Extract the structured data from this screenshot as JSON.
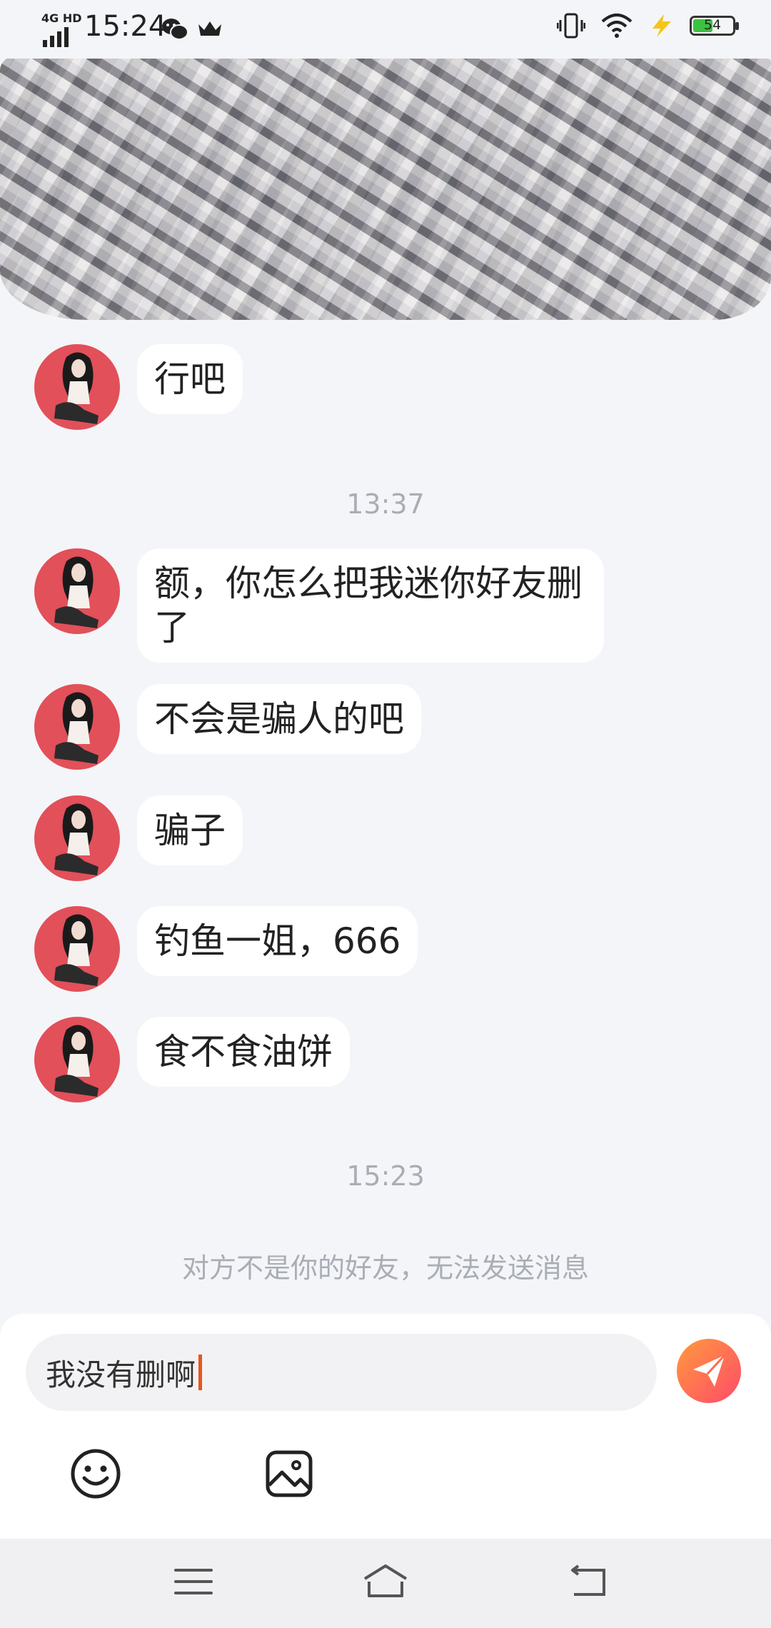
{
  "status_bar": {
    "time": "15:24",
    "network": "4G HD",
    "battery": "54",
    "battery_level": 0.54,
    "icons": [
      "signal-icon",
      "wechat-icon",
      "crown-icon",
      "vibrate-icon",
      "wifi-icon",
      "charging-icon",
      "battery-icon"
    ]
  },
  "messages_top": [
    {
      "text": "行吧"
    }
  ],
  "timestamps": [
    "13:37",
    "15:23"
  ],
  "messages_main": [
    {
      "text": "额，你怎么把我迷你好友删了"
    },
    {
      "text": "不会是骗人的吧"
    },
    {
      "text": "骗子"
    },
    {
      "text": "钓鱼一姐，666"
    },
    {
      "text": "食不食油饼"
    }
  ],
  "notice": "对方不是你的好友，无法发送消息",
  "composer": {
    "value": "我没有删啊",
    "send_icon": "send-icon",
    "emoji_icon": "emoji-icon",
    "image_icon": "image-icon"
  },
  "navigation": [
    "menu-icon",
    "home-icon",
    "back-icon"
  ],
  "colors": {
    "background": "#f4f5f8",
    "bubble": "#ffffff",
    "avatar": "#e2505a",
    "send_gradient_start": "#ff9a3c",
    "send_gradient_end": "#ff4b6a",
    "caret": "#e8551c",
    "muted_text": "#a9adb5"
  }
}
